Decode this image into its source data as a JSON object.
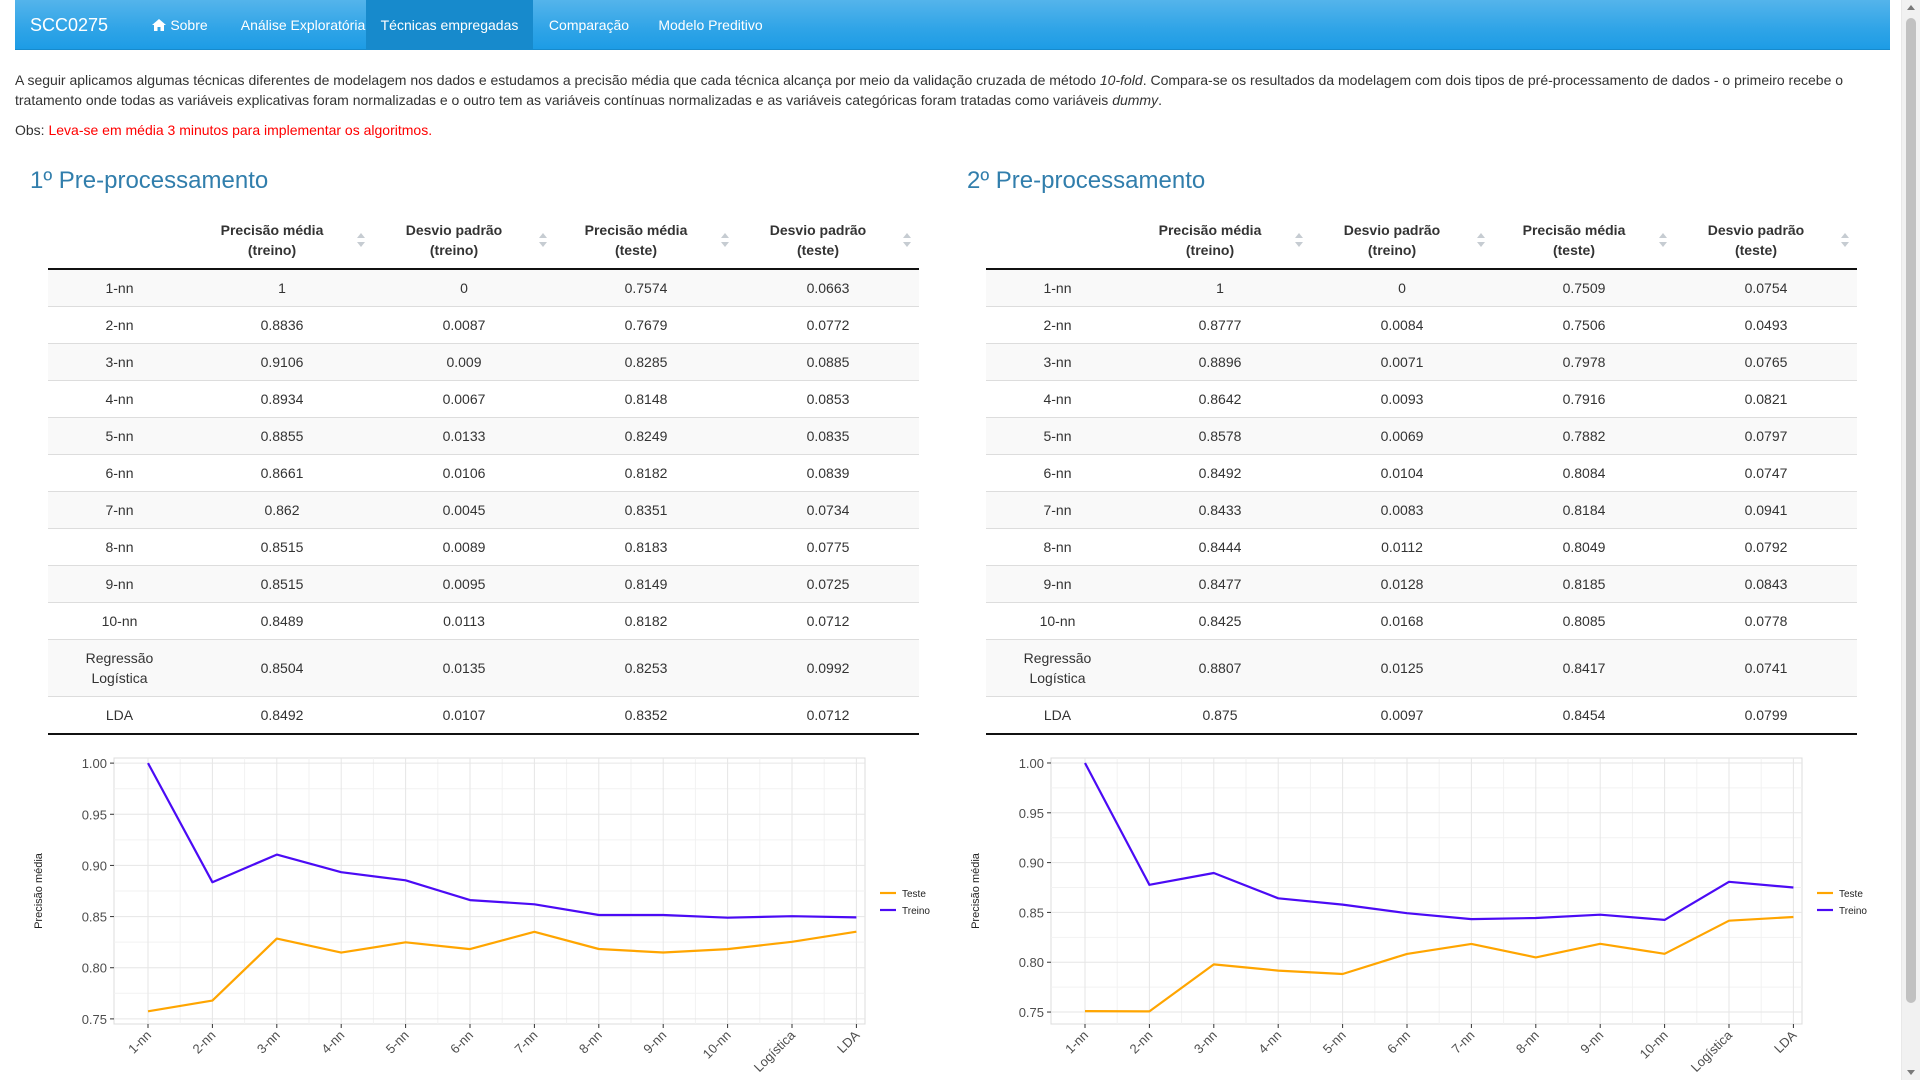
{
  "navbar": {
    "brand": "SCC0275",
    "items": [
      {
        "label": "Sobre",
        "icon": "home-icon"
      },
      {
        "label": "Análise Exploratória"
      },
      {
        "label": "Técnicas empregadas",
        "active": true
      },
      {
        "label": "Comparação"
      },
      {
        "label": "Modelo Preditivo"
      }
    ]
  },
  "intro": {
    "p1_a": "A seguir aplicamos algumas técnicas diferentes de modelagem nos dados e estudamos a precisão média que cada técnica alcança por meio da validação cruzada de método ",
    "p1_em1": "10-fold",
    "p1_b": ". Compara-se os resultados da modelagem com dois tipos de pré-processamento de dados - o primeiro recebe o tratamento onde todas as variáveis explicativas foram normalizadas e o outro tem as variáveis contínuas normalizadas e as variáveis categóricas foram tratadas como variáveis ",
    "p1_em2": "dummy",
    "p1_c": ".",
    "obs_label": "Obs: ",
    "obs_text": "Leva-se em média 3 minutos para implementar os algoritmos."
  },
  "colors": {
    "navbar": "#2fa4e7",
    "navbar_active": "#178acc",
    "heading": "#317eac",
    "warning": "#ff0000",
    "teste_line": "#ffa500",
    "treino_line": "#4b0bf5"
  },
  "headers": [
    [
      "Precisão média",
      "(treino)"
    ],
    [
      "Desvio padrão",
      "(treino)"
    ],
    [
      "Precisão média",
      "(teste)"
    ],
    [
      "Desvio padrão",
      "(teste)"
    ]
  ],
  "sections": [
    {
      "title": "1º Pre-processamento",
      "rows": [
        [
          "1-nn",
          "1",
          "0",
          "0.7574",
          "0.0663"
        ],
        [
          "2-nn",
          "0.8836",
          "0.0087",
          "0.7679",
          "0.0772"
        ],
        [
          "3-nn",
          "0.9106",
          "0.009",
          "0.8285",
          "0.0885"
        ],
        [
          "4-nn",
          "0.8934",
          "0.0067",
          "0.8148",
          "0.0853"
        ],
        [
          "5-nn",
          "0.8855",
          "0.0133",
          "0.8249",
          "0.0835"
        ],
        [
          "6-nn",
          "0.8661",
          "0.0106",
          "0.8182",
          "0.0839"
        ],
        [
          "7-nn",
          "0.862",
          "0.0045",
          "0.8351",
          "0.0734"
        ],
        [
          "8-nn",
          "0.8515",
          "0.0089",
          "0.8183",
          "0.0775"
        ],
        [
          "9-nn",
          "0.8515",
          "0.0095",
          "0.8149",
          "0.0725"
        ],
        [
          "10-nn",
          "0.8489",
          "0.0113",
          "0.8182",
          "0.0712"
        ],
        [
          "Regressão Logística",
          "0.8504",
          "0.0135",
          "0.8253",
          "0.0992"
        ],
        [
          "LDA",
          "0.8492",
          "0.0107",
          "0.8352",
          "0.0712"
        ]
      ]
    },
    {
      "title": "2º Pre-processamento",
      "rows": [
        [
          "1-nn",
          "1",
          "0",
          "0.7509",
          "0.0754"
        ],
        [
          "2-nn",
          "0.8777",
          "0.0084",
          "0.7506",
          "0.0493"
        ],
        [
          "3-nn",
          "0.8896",
          "0.0071",
          "0.7978",
          "0.0765"
        ],
        [
          "4-nn",
          "0.8642",
          "0.0093",
          "0.7916",
          "0.0821"
        ],
        [
          "5-nn",
          "0.8578",
          "0.0069",
          "0.7882",
          "0.0797"
        ],
        [
          "6-nn",
          "0.8492",
          "0.0104",
          "0.8084",
          "0.0747"
        ],
        [
          "7-nn",
          "0.8433",
          "0.0083",
          "0.8184",
          "0.0941"
        ],
        [
          "8-nn",
          "0.8444",
          "0.0112",
          "0.8049",
          "0.0792"
        ],
        [
          "9-nn",
          "0.8477",
          "0.0128",
          "0.8185",
          "0.0843"
        ],
        [
          "10-nn",
          "0.8425",
          "0.0168",
          "0.8085",
          "0.0778"
        ],
        [
          "Regressão Logística",
          "0.8807",
          "0.0125",
          "0.8417",
          "0.0741"
        ],
        [
          "LDA",
          "0.875",
          "0.0097",
          "0.8454",
          "0.0799"
        ]
      ]
    }
  ],
  "chart_data": [
    {
      "type": "line",
      "ylabel": "Precisão média",
      "xlabel": "",
      "categories": [
        "1-nn",
        "2-nn",
        "3-nn",
        "4-nn",
        "5-nn",
        "6-nn",
        "7-nn",
        "8-nn",
        "9-nn",
        "10-nn",
        "Logística",
        "LDA"
      ],
      "ylim": [
        0.745,
        1.005
      ],
      "yticks": [
        0.75,
        0.8,
        0.85,
        0.9,
        0.95,
        1.0
      ],
      "ytick_labels": [
        "0.75",
        "0.80",
        "0.85",
        "0.90",
        "0.95",
        "1.00"
      ],
      "grid": true,
      "legend": "right",
      "series": [
        {
          "name": "Teste",
          "color": "#ffa500",
          "values": [
            0.7574,
            0.7679,
            0.8285,
            0.8148,
            0.8249,
            0.8182,
            0.8351,
            0.8183,
            0.8149,
            0.8182,
            0.8253,
            0.8352
          ]
        },
        {
          "name": "Treino",
          "color": "#4b0bf5",
          "values": [
            1,
            0.8836,
            0.9106,
            0.8934,
            0.8855,
            0.8661,
            0.862,
            0.8515,
            0.8515,
            0.8489,
            0.8504,
            0.8492
          ]
        }
      ]
    },
    {
      "type": "line",
      "ylabel": "Precisão média",
      "xlabel": "",
      "categories": [
        "1-nn",
        "2-nn",
        "3-nn",
        "4-nn",
        "5-nn",
        "6-nn",
        "7-nn",
        "8-nn",
        "9-nn",
        "10-nn",
        "Logística",
        "LDA"
      ],
      "ylim": [
        0.738,
        1.005
      ],
      "yticks": [
        0.75,
        0.8,
        0.85,
        0.9,
        0.95,
        1.0
      ],
      "ytick_labels": [
        "0.75",
        "0.80",
        "0.85",
        "0.90",
        "0.95",
        "1.00"
      ],
      "grid": true,
      "legend": "right",
      "series": [
        {
          "name": "Teste",
          "color": "#ffa500",
          "values": [
            0.7509,
            0.7506,
            0.7978,
            0.7916,
            0.7882,
            0.8084,
            0.8184,
            0.8049,
            0.8185,
            0.8085,
            0.8417,
            0.8454
          ]
        },
        {
          "name": "Treino",
          "color": "#4b0bf5",
          "values": [
            1,
            0.8777,
            0.8896,
            0.8642,
            0.8578,
            0.8492,
            0.8433,
            0.8444,
            0.8477,
            0.8425,
            0.8807,
            0.875
          ]
        }
      ]
    }
  ]
}
